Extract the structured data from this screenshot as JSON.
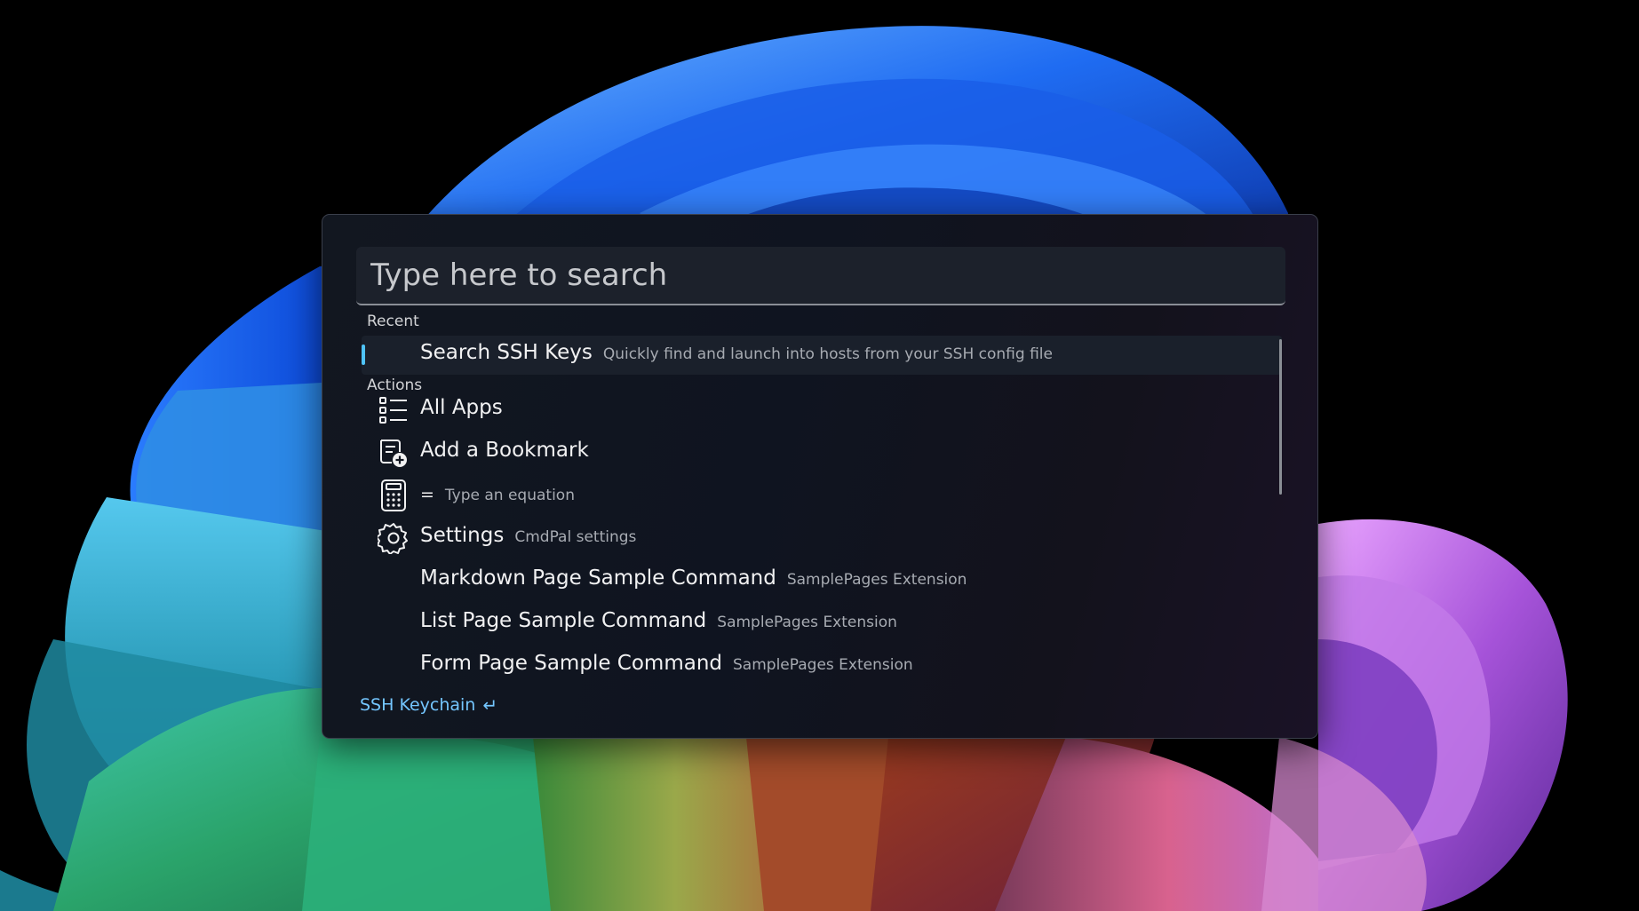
{
  "search": {
    "placeholder": "Type here to search",
    "value": ""
  },
  "sections": {
    "recent": "Recent",
    "actions": "Actions"
  },
  "recent_items": [
    {
      "title": "Search SSH Keys",
      "subtitle": "Quickly find and launch into hosts from your SSH config file",
      "selected": true
    }
  ],
  "action_items": [
    {
      "title": "All Apps",
      "subtitle": "",
      "icon": "list-icon"
    },
    {
      "title": "Add a Bookmark",
      "subtitle": "",
      "icon": "bookmark-add-icon"
    },
    {
      "title": "=",
      "subtitle": "Type an equation",
      "icon": "calculator-icon"
    },
    {
      "title": "Settings",
      "subtitle": "CmdPal settings",
      "icon": "gear-icon"
    },
    {
      "title": "Markdown Page Sample Command",
      "subtitle": "SamplePages Extension",
      "icon": ""
    },
    {
      "title": "List Page Sample Command",
      "subtitle": "SamplePages Extension",
      "icon": ""
    },
    {
      "title": "Form Page Sample Command",
      "subtitle": "SamplePages Extension",
      "icon": ""
    }
  ],
  "footer": {
    "label": "SSH Keychain",
    "enter_glyph": "↵"
  },
  "colors": {
    "accent": "#4fc3f7",
    "footer_text": "#74c6ff",
    "palette_bg": "#111620"
  }
}
